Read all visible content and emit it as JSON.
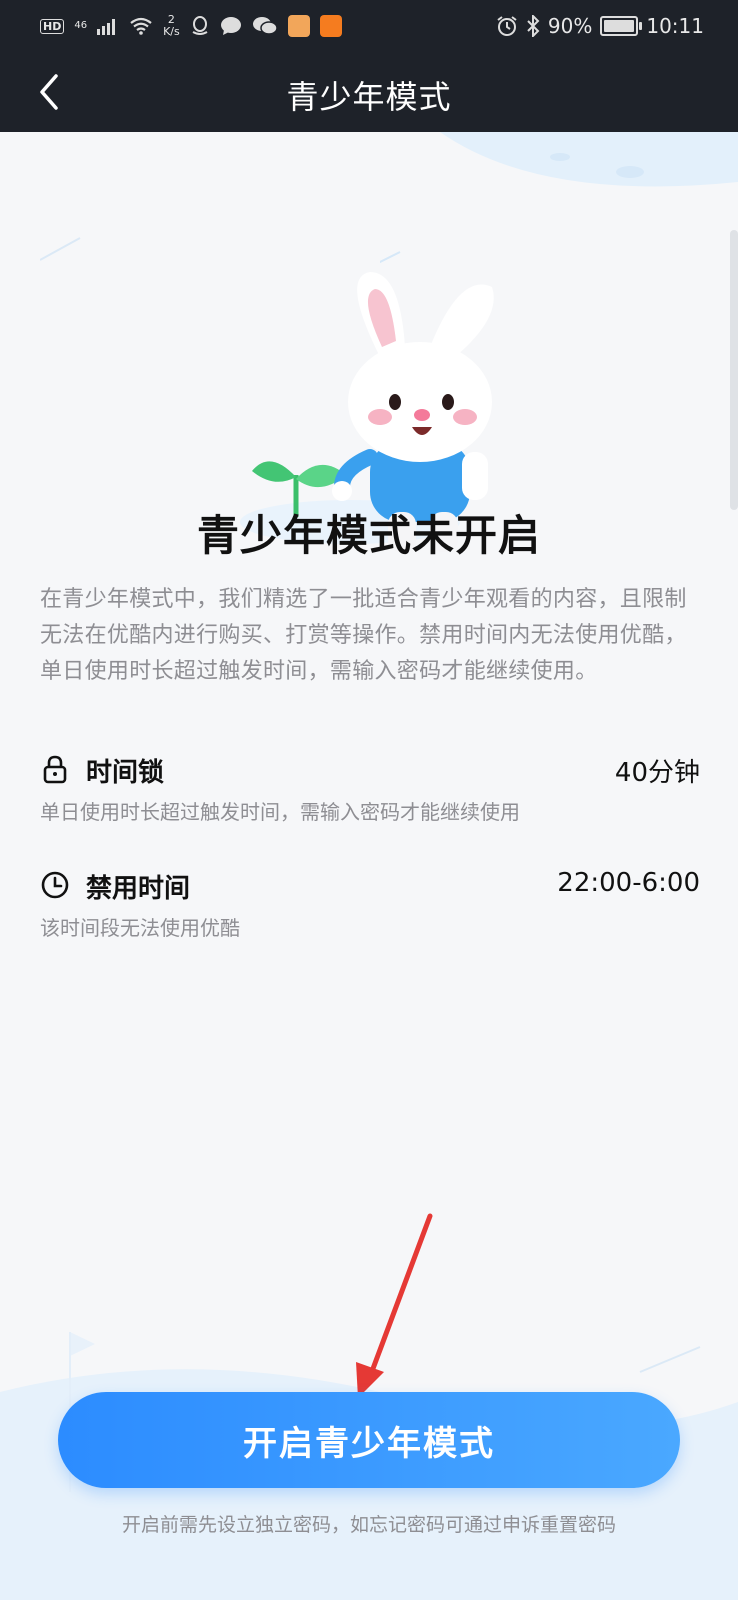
{
  "status_bar": {
    "hd": "HD",
    "network": "46",
    "speed_value": "2",
    "speed_unit": "K/s",
    "battery": "90%",
    "time": "10:11"
  },
  "header": {
    "title": "青少年模式"
  },
  "main": {
    "heading": "青少年模式未开启",
    "description": "在青少年模式中，我们精选了一批适合青少年观看的内容，且限制无法在优酷内进行购买、打赏等操作。禁用时间内无法使用优酷，单日使用时长超过触发时间，需输入密码才能继续使用。",
    "settings": [
      {
        "icon": "lock-icon",
        "title": "时间锁",
        "value": "40分钟",
        "subtitle": "单日使用时长超过触发时间，需输入密码才能继续使用"
      },
      {
        "icon": "clock-icon",
        "title": "禁用时间",
        "value": "22:00-6:00",
        "subtitle": "该时间段无法使用优酷"
      }
    ]
  },
  "footer": {
    "button_label": "开启青少年模式",
    "note": "开启前需先设立独立密码，如忘记密码可通过申诉重置密码"
  },
  "colors": {
    "header_bg": "#1e2229",
    "accent": "#2c8cff",
    "arrow": "#e53935"
  }
}
